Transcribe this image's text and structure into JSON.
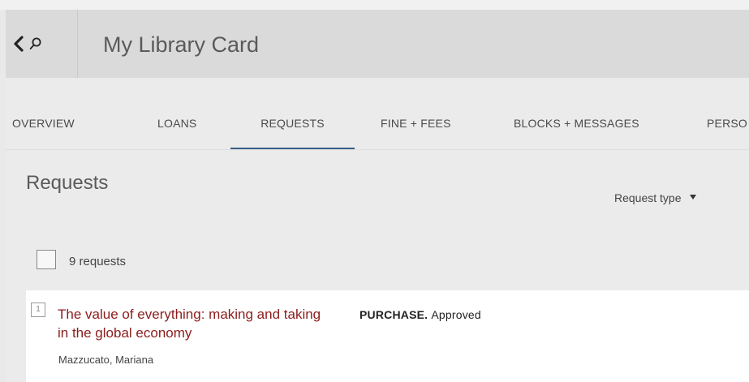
{
  "header": {
    "title": "My Library Card"
  },
  "tabs": [
    {
      "label": "OVERVIEW"
    },
    {
      "label": "LOANS"
    },
    {
      "label": "REQUESTS",
      "active": true
    },
    {
      "label": "FINE + FEES"
    },
    {
      "label": "BLOCKS + MESSAGES"
    },
    {
      "label": "PERSO"
    }
  ],
  "section": {
    "title": "Requests",
    "filter_label": "Request type",
    "count_label": "9 requests"
  },
  "requests": [
    {
      "index": "1",
      "title": "The value of everything: making and taking in the global economy",
      "author": "Mazzucato, Mariana",
      "status_type": "PURCHASE.",
      "status_value": "Approved"
    }
  ],
  "colors": {
    "accent_underline": "#375f84",
    "title_link": "#8c1c1c"
  },
  "icons": {
    "back": "chevron-left-icon",
    "search": "search-icon",
    "dropdown": "caret-down-icon"
  }
}
